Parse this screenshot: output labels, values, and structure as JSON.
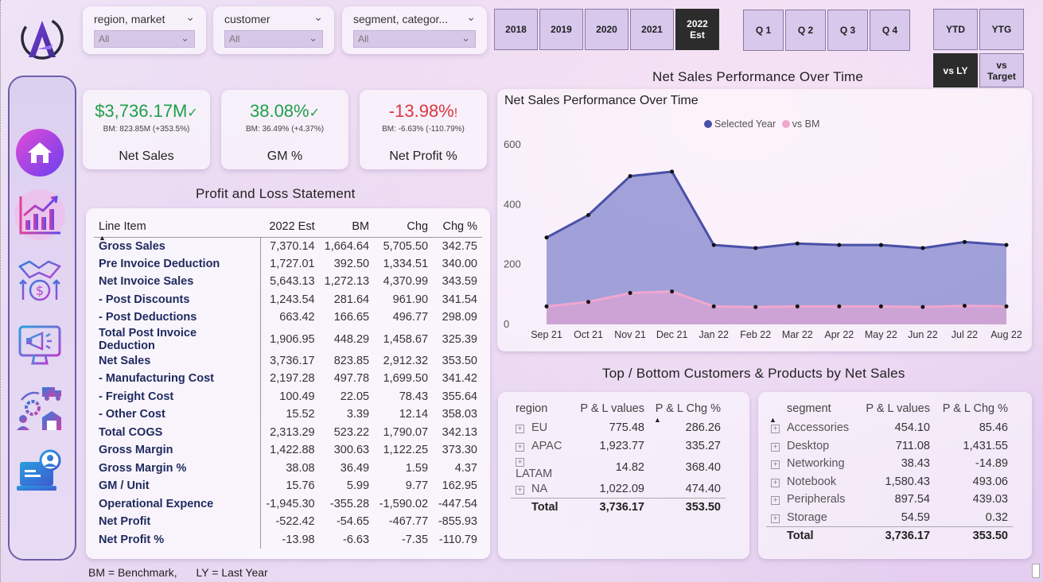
{
  "slicers": [
    {
      "title": "region, market",
      "value": "All"
    },
    {
      "title": "customer",
      "value": "All"
    },
    {
      "title": "segment, categor...",
      "value": "All"
    }
  ],
  "years": [
    "2018",
    "2019",
    "2020",
    "2021",
    "2022\nEst"
  ],
  "quarters": [
    "Q 1",
    "Q 2",
    "Q 3",
    "Q 4"
  ],
  "ytd_label": "YTD",
  "ytg_label": "YTG",
  "vs_ly_label": "vs LY",
  "vs_target_label": "vs\nTarget",
  "kpis": [
    {
      "value": "$3,736.17M",
      "mark": "✓",
      "bm": "BM: 823.85M (+353.5%)",
      "label": "Net Sales",
      "color": "#1fa04a"
    },
    {
      "value": "38.08%",
      "mark": "✓",
      "bm": "BM: 36.49% (+4.37%)",
      "label": "GM %",
      "color": "#1fa04a"
    },
    {
      "value": "-13.98%",
      "mark": "!",
      "bm": "BM: -6.63% (-110.79%)",
      "label": "Net Profit %",
      "color": "#d9383f"
    }
  ],
  "pl": {
    "title": "Profit and Loss Statement",
    "columns": [
      "Line Item",
      "2022 Est",
      "BM",
      "Chg",
      "Chg %"
    ],
    "rows": [
      [
        "Gross Sales",
        "7,370.14",
        "1,664.64",
        "5,705.50",
        "342.75"
      ],
      [
        "Pre Invoice Deduction",
        "1,727.01",
        "392.50",
        "1,334.51",
        "340.00"
      ],
      [
        "Net Invoice Sales",
        "5,643.13",
        "1,272.13",
        "4,370.99",
        "343.59"
      ],
      [
        " - Post Discounts",
        "1,243.54",
        "281.64",
        "961.90",
        "341.54"
      ],
      [
        " - Post Deductions",
        "663.42",
        "166.65",
        "496.77",
        "298.09"
      ],
      [
        "Total Post Invoice Deduction",
        "1,906.95",
        "448.29",
        "1,458.67",
        "325.39"
      ],
      [
        "Net Sales",
        "3,736.17",
        "823.85",
        "2,912.32",
        "353.50"
      ],
      [
        " - Manufacturing Cost",
        "2,197.28",
        "497.78",
        "1,699.50",
        "341.42"
      ],
      [
        " - Freight Cost",
        "100.49",
        "22.05",
        "78.43",
        "355.64"
      ],
      [
        " - Other Cost",
        "15.52",
        "3.39",
        "12.14",
        "358.03"
      ],
      [
        "Total COGS",
        "2,313.29",
        "523.22",
        "1,790.07",
        "342.13"
      ],
      [
        "Gross Margin",
        "1,422.88",
        "300.63",
        "1,122.25",
        "373.30"
      ],
      [
        "Gross Margin %",
        "38.08",
        "36.49",
        "1.59",
        "4.37"
      ],
      [
        "GM / Unit",
        "15.76",
        "5.99",
        "9.77",
        "162.95"
      ],
      [
        "Operational Expence",
        "-1,945.30",
        "-355.28",
        "-1,590.02",
        "-447.54"
      ],
      [
        "Net Profit",
        "-522.42",
        "-54.65",
        "-467.77",
        "-855.93"
      ],
      [
        "Net Profit %",
        "-13.98",
        "-6.63",
        "-7.35",
        "-110.79"
      ]
    ]
  },
  "chart_header": "Net Sales  Performance Over Time",
  "chart_data": {
    "type": "area",
    "title": "Net Sales Performance Over Time",
    "categories": [
      "Sep 21",
      "Oct 21",
      "Nov 21",
      "Dec 21",
      "Jan 22",
      "Feb 22",
      "Mar 22",
      "Apr 22",
      "May 22",
      "Jun 22",
      "Jul 22",
      "Aug 22"
    ],
    "series": [
      {
        "name": "Selected Year",
        "color": "#4a50a8",
        "values": [
          290,
          365,
          495,
          510,
          265,
          255,
          270,
          265,
          265,
          255,
          275,
          265
        ]
      },
      {
        "name": "vs BM",
        "color": "#f0a6cf",
        "values": [
          60,
          75,
          105,
          110,
          60,
          58,
          60,
          60,
          60,
          58,
          62,
          60
        ]
      }
    ],
    "yticks": [
      0,
      200,
      400,
      600
    ],
    "ylim": [
      0,
      600
    ],
    "legend": "top-center",
    "grid": false
  },
  "bottom_title": "Top / Bottom  Customers & Products by  Net Sales",
  "region_table": {
    "columns": [
      "region",
      "P & L values",
      "P & L Chg %"
    ],
    "rows": [
      [
        "EU",
        "775.48",
        "286.26"
      ],
      [
        "APAC",
        "1,923.77",
        "335.27"
      ],
      [
        "LATAM",
        "14.82",
        "368.40"
      ],
      [
        "NA",
        "1,022.09",
        "474.40"
      ]
    ],
    "total": [
      "Total",
      "3,736.17",
      "353.50"
    ]
  },
  "segment_table": {
    "columns": [
      "segment",
      "P & L values",
      "P & L Chg %"
    ],
    "rows": [
      [
        "Accessories",
        "454.10",
        "85.46"
      ],
      [
        "Desktop",
        "711.08",
        "1,431.55"
      ],
      [
        "Networking",
        "38.43",
        "-14.89"
      ],
      [
        "Notebook",
        "1,580.43",
        "493.06"
      ],
      [
        "Peripherals",
        "897.54",
        "439.03"
      ],
      [
        "Storage",
        "54.59",
        "0.32"
      ]
    ],
    "total": [
      "Total",
      "3,736.17",
      "353.50"
    ]
  },
  "footer": {
    "bm": "BM = Benchmark,",
    "ly": "LY = Last Year"
  }
}
